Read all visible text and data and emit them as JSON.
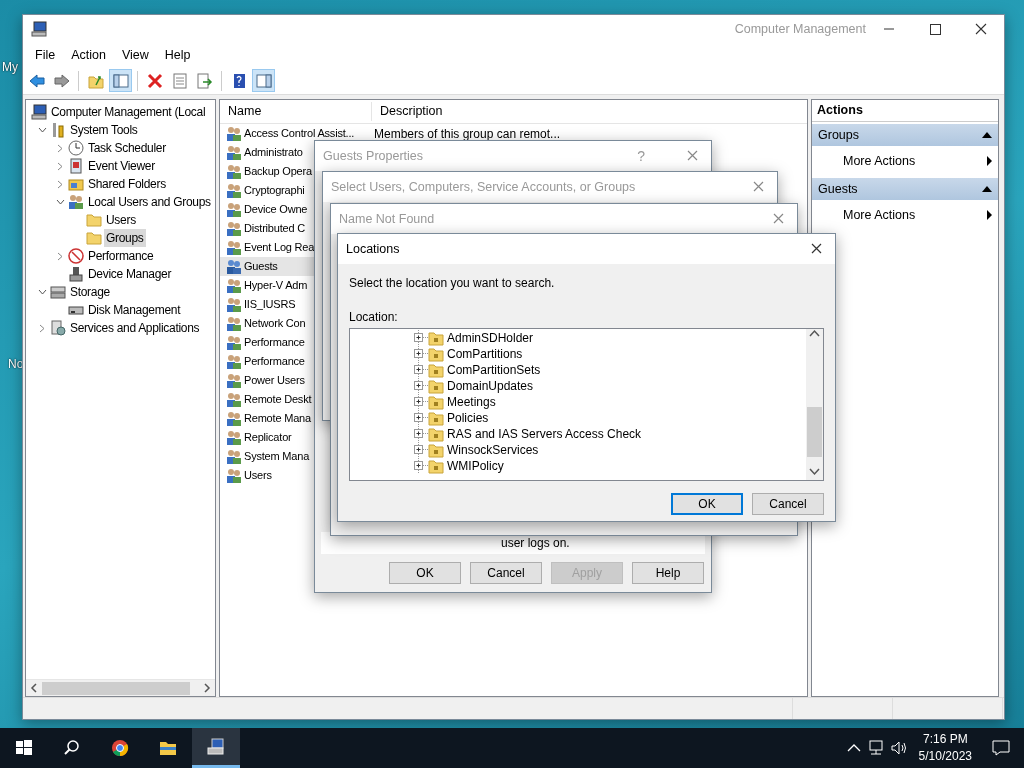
{
  "desktop": {
    "labels": [
      "My",
      "No"
    ]
  },
  "window": {
    "title": "Computer Management",
    "active": false
  },
  "menu": [
    "File",
    "Action",
    "View",
    "Help"
  ],
  "toolbar": [
    {
      "kind": "back",
      "pressed": false
    },
    {
      "kind": "forward",
      "pressed": false
    },
    {
      "kind": "separator"
    },
    {
      "kind": "up",
      "pressed": false
    },
    {
      "kind": "tree",
      "pressed": true
    },
    {
      "kind": "separator"
    },
    {
      "kind": "delete",
      "pressed": false
    },
    {
      "kind": "properties",
      "pressed": false
    },
    {
      "kind": "export",
      "pressed": false
    },
    {
      "kind": "separator"
    },
    {
      "kind": "help",
      "pressed": false
    },
    {
      "kind": "pane",
      "pressed": true
    }
  ],
  "tree": {
    "label": "Computer Management (Local",
    "kind": "computer",
    "selected": false,
    "children": [
      {
        "label": "System Tools",
        "kind": "tools",
        "expanded": true,
        "selected": false,
        "children": [
          {
            "label": "Task Scheduler",
            "kind": "clock",
            "expanded": false,
            "selected": false
          },
          {
            "label": "Event Viewer",
            "kind": "log",
            "expanded": false,
            "selected": false
          },
          {
            "label": "Shared Folders",
            "kind": "share",
            "expanded": false,
            "selected": false
          },
          {
            "label": "Local Users and Groups",
            "kind": "users",
            "expanded": true,
            "selected": false,
            "children": [
              {
                "label": "Users",
                "kind": "folder",
                "selected": false
              },
              {
                "label": "Groups",
                "kind": "folder",
                "selected": true
              }
            ]
          },
          {
            "label": "Performance",
            "kind": "performance",
            "expanded": false,
            "selected": false
          },
          {
            "label": "Device Manager",
            "kind": "device",
            "selected": false
          }
        ]
      },
      {
        "label": "Storage",
        "kind": "storage",
        "expanded": true,
        "selected": false,
        "children": [
          {
            "label": "Disk Management",
            "kind": "disk",
            "selected": false
          }
        ]
      },
      {
        "label": "Services and Applications",
        "kind": "services",
        "expanded": false,
        "selected": false
      }
    ]
  },
  "list": {
    "columns": [
      "Name",
      "Description"
    ],
    "rows": [
      {
        "name": "Access Control Assist...",
        "description": "Members of this group can remot...",
        "selected": false
      },
      {
        "name": "Administrato",
        "selected": false
      },
      {
        "name": "Backup Opera",
        "selected": false
      },
      {
        "name": "Cryptographi",
        "selected": false
      },
      {
        "name": "Device Owne",
        "selected": false
      },
      {
        "name": "Distributed C",
        "selected": false
      },
      {
        "name": "Event Log Rea",
        "selected": false
      },
      {
        "name": "Guests",
        "selected": true
      },
      {
        "name": "Hyper-V Adm",
        "selected": false
      },
      {
        "name": "IIS_IUSRS",
        "selected": false
      },
      {
        "name": "Network Con",
        "selected": false
      },
      {
        "name": "Performance",
        "selected": false
      },
      {
        "name": "Performance",
        "selected": false
      },
      {
        "name": "Power Users",
        "selected": false
      },
      {
        "name": "Remote Deskt",
        "selected": false
      },
      {
        "name": "Remote Mana",
        "selected": false
      },
      {
        "name": "Replicator",
        "selected": false
      },
      {
        "name": "System Mana",
        "selected": false
      },
      {
        "name": "Users",
        "selected": false
      }
    ]
  },
  "actions": {
    "title": "Actions",
    "sections": [
      {
        "title": "Groups",
        "expanded": true,
        "items": [
          "More Actions"
        ]
      },
      {
        "title": "Guests",
        "expanded": true,
        "items": [
          "More Actions"
        ]
      }
    ]
  },
  "guests_properties": {
    "title": "Guests Properties",
    "help": "?",
    "active": false,
    "note": "user logs on.",
    "buttons": [
      {
        "label": "OK",
        "disabled": false
      },
      {
        "label": "Cancel",
        "disabled": false
      },
      {
        "label": "Apply",
        "disabled": true
      },
      {
        "label": "Help",
        "disabled": false
      }
    ]
  },
  "select_users": {
    "title": "Select Users, Computers, Service Accounts, or Groups",
    "active": false
  },
  "name_not_found": {
    "title": "Name Not Found",
    "active": false
  },
  "locations": {
    "title": "Locations",
    "active": true,
    "prompt": "Select the location you want to search.",
    "label": "Location:",
    "items": [
      "AdminSDHolder",
      "ComPartitions",
      "ComPartitionSets",
      "DomainUpdates",
      "Meetings",
      "Policies",
      "RAS and IAS Servers Access Check",
      "WinsockServices",
      "WMIPolicy"
    ],
    "buttons": [
      {
        "label": "OK",
        "default": true
      },
      {
        "label": "Cancel",
        "default": false
      }
    ]
  },
  "taskbar": {
    "apps": [
      {
        "kind": "start",
        "active": false
      },
      {
        "kind": "search",
        "active": false
      },
      {
        "kind": "browser",
        "active": false
      },
      {
        "kind": "folder",
        "active": false
      },
      {
        "kind": "mmc",
        "active": true
      }
    ],
    "time": "7:16 PM",
    "date": "5/10/2023"
  }
}
